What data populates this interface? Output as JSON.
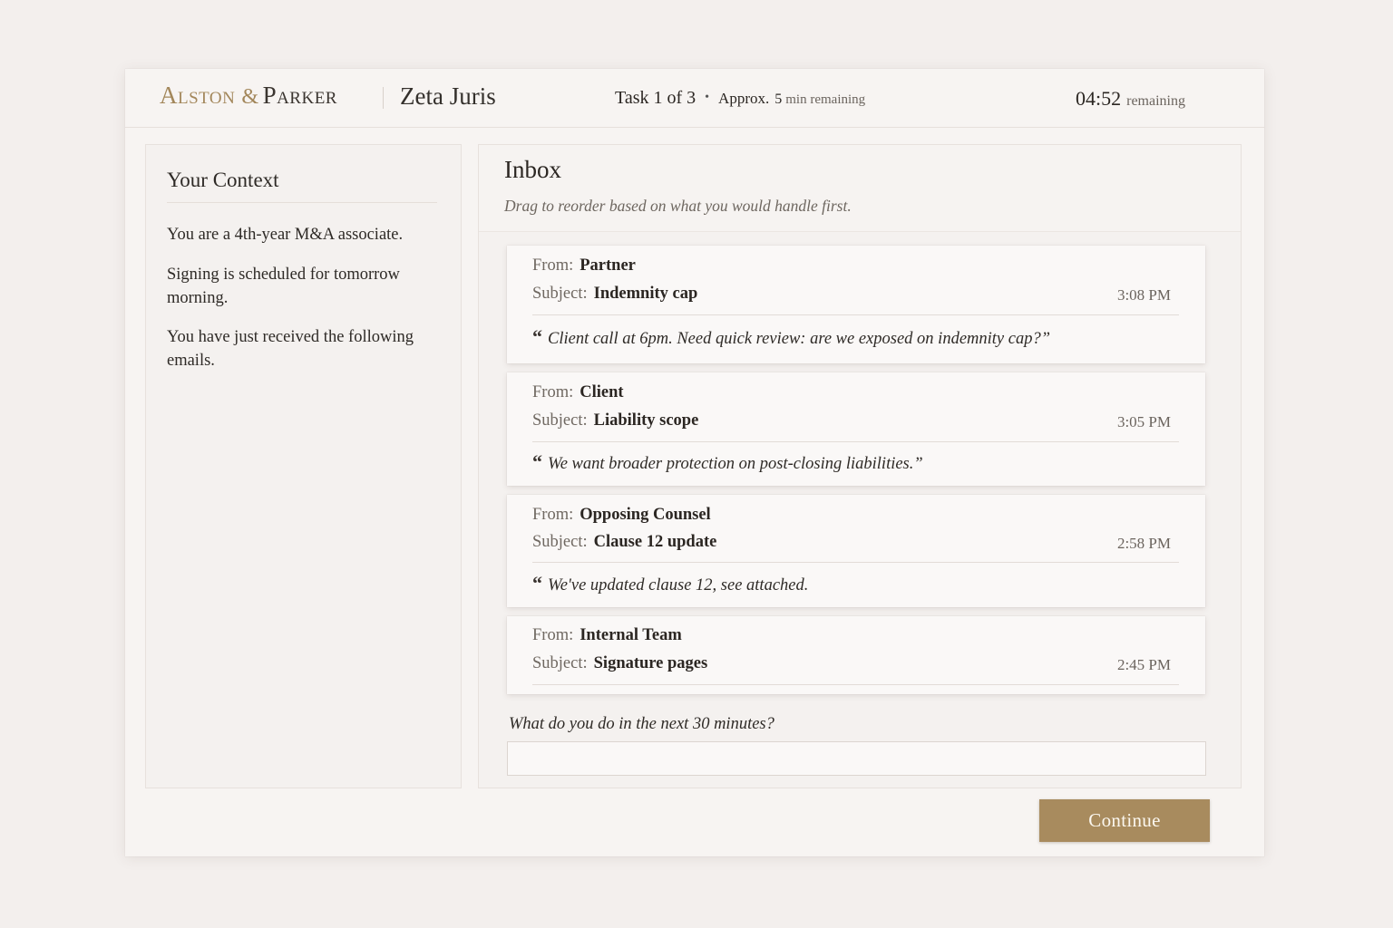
{
  "header": {
    "brand_first": "Alston",
    "brand_amp": "&",
    "brand_second": "Parker",
    "product": "Zeta Juris",
    "task": "Task 1 of 3",
    "approx_label": "Approx.",
    "approx_num": "5",
    "approx_unit": "min remaining",
    "timer_value": "04:52",
    "timer_label": "remaining"
  },
  "context": {
    "title": "Your Context",
    "lines": [
      "You are a 4th-year M&A associate.",
      "Signing is scheduled for tomorrow morning.",
      "You have just received the following emails."
    ]
  },
  "inbox": {
    "title": "Inbox",
    "hint": "Drag to reorder based on what you would handle first.",
    "from_label": "From:",
    "subject_label": "Subject:",
    "quote_mark": "“",
    "emails": [
      {
        "from": "Partner",
        "subject": "Indemnity cap",
        "time": "3:08 PM",
        "quote": "Client call at 6pm. Need quick review: are we exposed on indemnity cap?”"
      },
      {
        "from": "Client",
        "subject": "Liability scope",
        "time": "3:05 PM",
        "quote": "We want broader protection on post-closing liabilities.”"
      },
      {
        "from": "Opposing Counsel",
        "subject": "Clause 12 update",
        "time": "2:58 PM",
        "quote": "We've updated clause 12,  see attached."
      },
      {
        "from": "Internal Team",
        "subject": "Signature pages",
        "time": "2:45 PM",
        "quote": ""
      }
    ],
    "question": "What do you do in the next 30 minutes?",
    "answer_value": ""
  },
  "actions": {
    "continue_label": "Continue"
  }
}
